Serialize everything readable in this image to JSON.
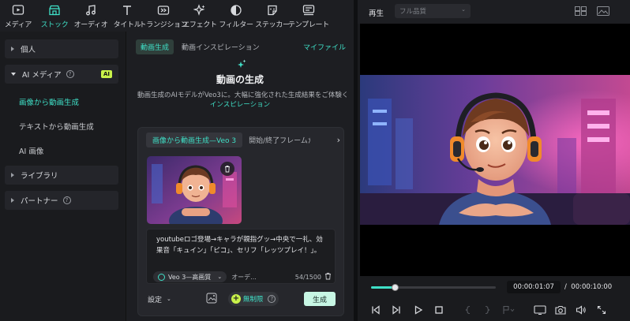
{
  "toolbar": {
    "items": [
      {
        "label": "メディア",
        "icon": "media-icon"
      },
      {
        "label": "ストック",
        "icon": "stock-icon",
        "active": true
      },
      {
        "label": "オーディオ",
        "icon": "music-note-icon"
      },
      {
        "label": "タイトル",
        "icon": "title-text-icon"
      },
      {
        "label": "トランジション",
        "icon": "transition-icon"
      },
      {
        "label": "エフェクト",
        "icon": "effect-icon"
      },
      {
        "label": "フィルター",
        "icon": "filter-icon"
      },
      {
        "label": "ステッカー",
        "icon": "sticker-icon"
      },
      {
        "label": "テンプレート",
        "icon": "template-icon"
      }
    ]
  },
  "sidebar": {
    "personal": "個人",
    "ai_media": "AI メディア",
    "ai_badge": "AI",
    "items": [
      "画像から動画生成",
      "テキストから動画生成",
      "AI 画像"
    ],
    "library": "ライブラリ",
    "partner": "パートナー"
  },
  "middle": {
    "tab_active": "動画生成",
    "tab_inspiration": "動画インスピレーション",
    "my_files": "マイファイル",
    "title": "動画の生成",
    "description": "動画生成のAIモデルがVeo3に。大幅に強化された生成結果をご体験く",
    "link": "インスピレーション",
    "card": {
      "tab_active": "画像から動画生成—Veo 3",
      "tab_other": "開始/終了フレームか",
      "more": "›",
      "prompt": "youtubeロゴ登場→キャラが親指グッ→中央で一礼、効果音「キュイン」「ピコ」、セリフ「レッツプレイ！」。",
      "model": "Veo 3—高画質",
      "audio": "オーデ...",
      "count": "54/1500",
      "settings": "設定",
      "unlimited": "無制限",
      "generate": "生成"
    }
  },
  "player": {
    "title": "再生",
    "quality": "フル品質",
    "current_time": "00:00:01:07",
    "separator": "/",
    "total_time": "00:00:10:00",
    "progress": 0.19
  },
  "colors": {
    "accent": "#3fe0c7",
    "badge": "#c9f24a",
    "generate_bg": "#c7f6e4"
  }
}
